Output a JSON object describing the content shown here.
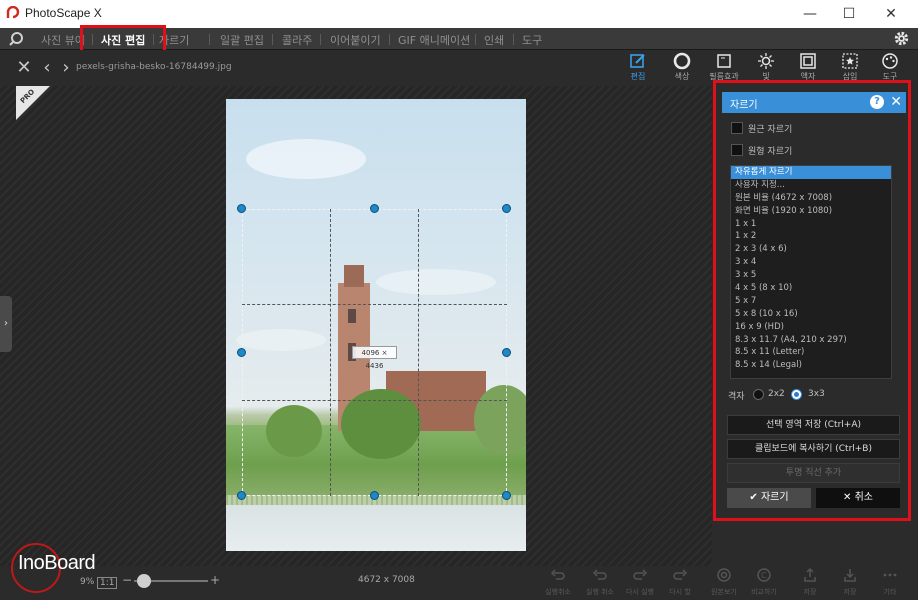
{
  "app": {
    "title": "PhotoScape X"
  },
  "window_controls": {
    "minimize": "—",
    "maximize": "☐",
    "close": "✕"
  },
  "menu": {
    "tabs": [
      "사진 뷰어",
      "사진 편집",
      "자르기",
      "일괄 편집",
      "콜라주",
      "이어붙이기",
      "GIF 애니메이션",
      "인쇄",
      "도구"
    ],
    "active_index": 1
  },
  "toolbar": {
    "filename": "pexels-grisha-besko-16784499.jpg",
    "tools": [
      "편집",
      "색상",
      "필름효과",
      "빛",
      "액자",
      "삽입",
      "도구"
    ]
  },
  "crop": {
    "dimension_label": "4096 × 4436"
  },
  "panel": {
    "title": "자르기",
    "help": "?",
    "close": "✕",
    "options": [
      "원근 자르기",
      "원형 자르기"
    ],
    "ratios": [
      "자유롭게 자르기",
      "사용자 지정...",
      "원본 비율 (4672 x 7008)",
      "화면 비율 (1920 x 1080)",
      "1 x 1",
      "1 x 2",
      "2 x 3 (4 x 6)",
      "3 x 4",
      "3 x 5",
      "4 x 5 (8 x 10)",
      "5 x 7",
      "5 x 8 (10 x 16)",
      "16 x 9 (HD)",
      "8.3 x 11.7 (A4, 210 x 297)",
      "8.5 x 11 (Letter)",
      "8.5 x 14 (Legal)"
    ],
    "selected_ratio_index": 0,
    "grid_label": "격자",
    "grid_options": [
      "2x2",
      "3x3"
    ],
    "grid_selected": "3x3",
    "buttons": [
      "선택 영역 저장 (Ctrl+A)",
      "클립보드에 복사하기 (Ctrl+B)",
      "투명 직선 추가"
    ],
    "crop_button": "자르기",
    "cancel_button": "취소"
  },
  "bottom": {
    "zoom": "9%",
    "ratio_btn": "1:1",
    "minus": "−",
    "plus": "+",
    "image_size": "4672 x 7008",
    "tools": [
      "실행취소",
      "실행 취소",
      "다시 실행",
      "다시 할",
      "원본보기",
      "비교하기",
      "저장",
      "저장",
      "기타"
    ]
  },
  "watermark": "InoBoard",
  "colors": {
    "accent": "#3a8fd9",
    "highlight": "#e0101a"
  }
}
